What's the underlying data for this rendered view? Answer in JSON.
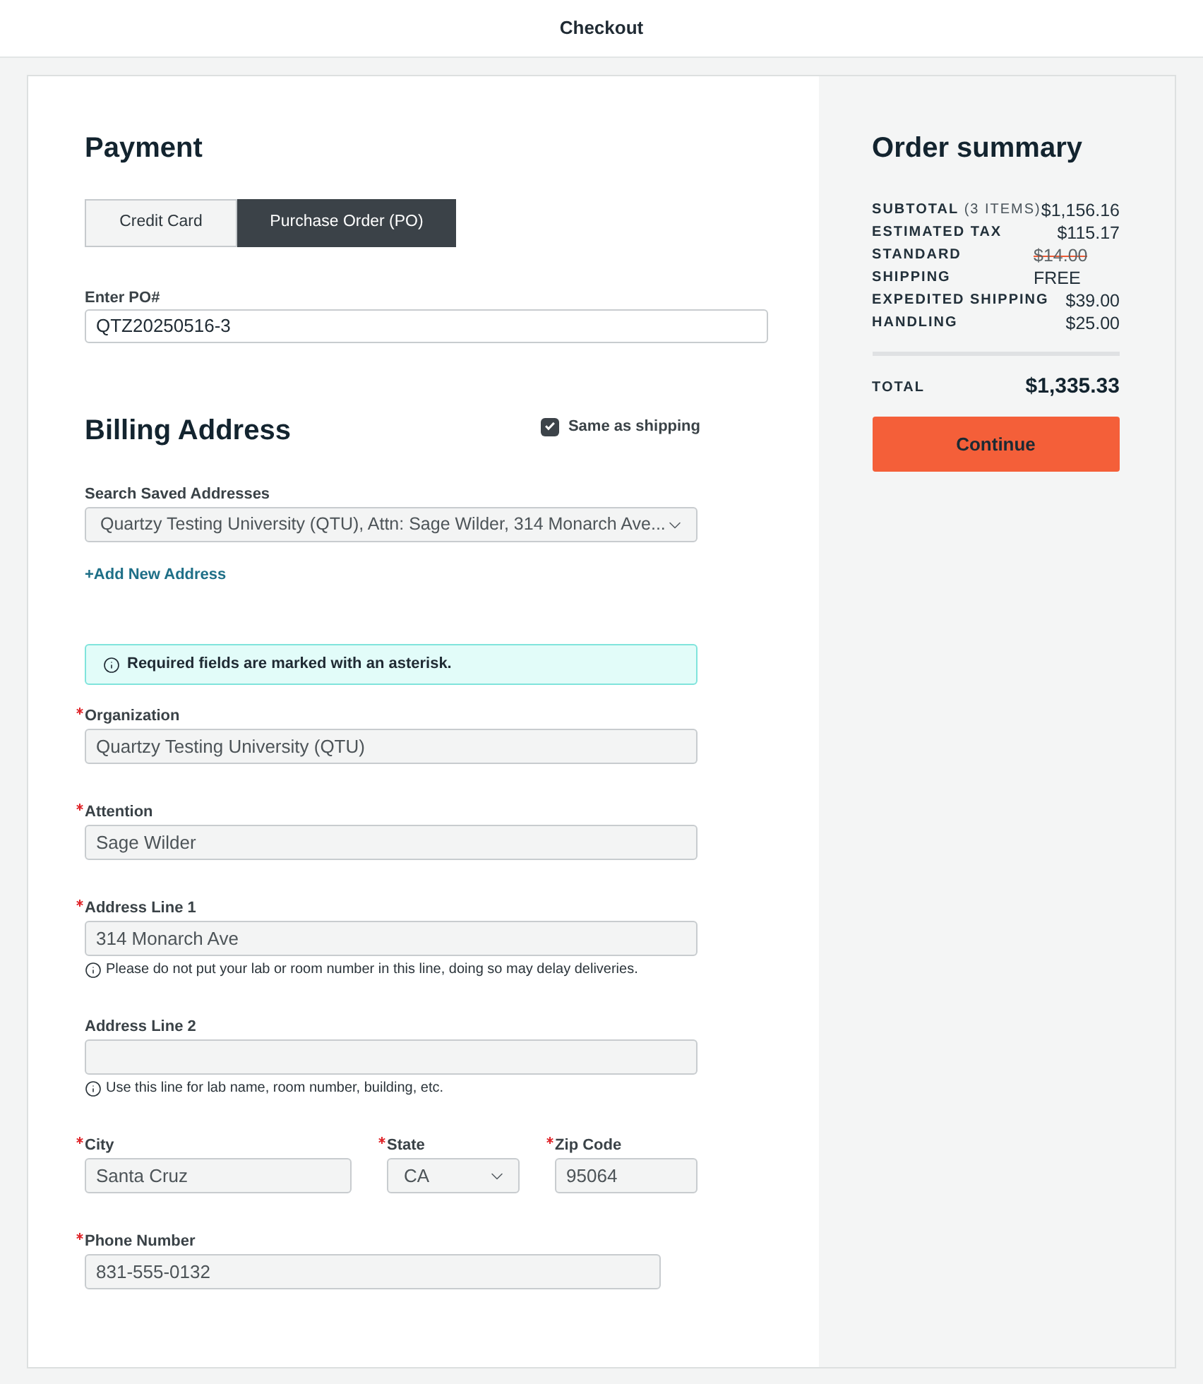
{
  "header": {
    "title": "Checkout"
  },
  "payment": {
    "title": "Payment",
    "tabs": [
      {
        "label": "Credit Card",
        "selected": false
      },
      {
        "label": "Purchase Order (PO)",
        "selected": true
      }
    ],
    "po_field": {
      "label": "Enter PO#",
      "value": "QTZ20250516-3"
    }
  },
  "billing": {
    "title": "Billing Address",
    "same_as_shipping": {
      "label": "Same as shipping",
      "checked": true
    },
    "saved_addresses": {
      "label": "Search Saved Addresses",
      "value": "Quartzy Testing University (QTU), Attn: Sage Wilder, 314 Monarch Ave...",
      "disabled": true
    },
    "add_link": "+Add New Address",
    "notice": "Required fields are marked with an asterisk.",
    "rows": [
      {
        "fields": [
          {
            "kind": "text",
            "label": "Organization",
            "required": true,
            "disabled": true,
            "value": "Quartzy Testing University (QTU)"
          }
        ]
      },
      {
        "fields": [
          {
            "kind": "text",
            "label": "Attention",
            "required": true,
            "disabled": true,
            "value": "Sage Wilder"
          }
        ]
      },
      {
        "fields": [
          {
            "kind": "text",
            "label": "Address Line 1",
            "required": true,
            "disabled": true,
            "value": "314 Monarch Ave",
            "hint": "Please do not put your lab or room number in this line, doing so may delay deliveries."
          }
        ]
      },
      {
        "fields": [
          {
            "kind": "text",
            "label": "Address Line 2",
            "required": false,
            "disabled": true,
            "hint": "Use this line for lab name, room number, building, etc."
          }
        ]
      },
      {
        "fields": [
          {
            "kind": "text",
            "label": "City",
            "required": true,
            "disabled": true,
            "value": "Santa Cruz"
          },
          {
            "kind": "select",
            "label": "State",
            "required": true,
            "disabled": true,
            "value": "CA"
          },
          {
            "kind": "text",
            "label": "Zip Code",
            "required": true,
            "disabled": true,
            "value": "95064"
          }
        ]
      },
      {
        "fields": [
          {
            "kind": "phone",
            "label": "Phone Number",
            "required": true,
            "disabled": true,
            "value": "831-555-0132"
          }
        ]
      }
    ]
  },
  "summary": {
    "title": "Order summary",
    "rows": [
      {
        "kind": "line",
        "label": "SUBTOTAL",
        "note": "(3 ITEMS)",
        "value": "$1,156.16"
      },
      {
        "kind": "line",
        "label": "ESTIMATED TAX",
        "value": "$115.17"
      },
      {
        "kind": "discounted",
        "label": "STANDARD SHIPPING",
        "old_value": "$14.00",
        "value": "FREE"
      },
      {
        "kind": "line",
        "label": "EXPEDITED SHIPPING",
        "value": "$39.00"
      },
      {
        "kind": "line",
        "label": "HANDLING",
        "value": "$25.00"
      }
    ],
    "total": {
      "label": "TOTAL",
      "value": "$1,335.33"
    },
    "button": "Continue"
  }
}
